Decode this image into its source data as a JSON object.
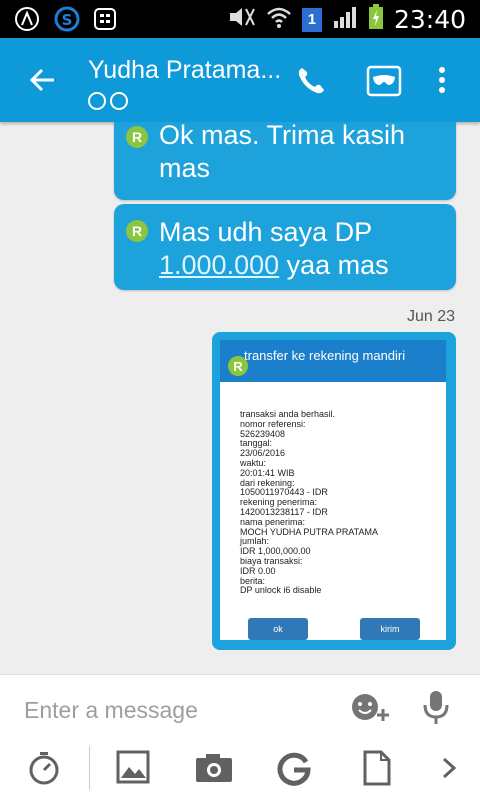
{
  "status_bar": {
    "time": "23:40",
    "sim_slot": "1",
    "icons": [
      "android-icon",
      "s-icon",
      "bbm-icon",
      "mute-icon",
      "wifi-icon",
      "signal-icon",
      "battery-charging-icon"
    ]
  },
  "app_bar": {
    "contact_name": "Yudha Pratama...",
    "back_icon": "back-arrow-icon",
    "call_icon": "phone-icon",
    "mask_icon": "mask-icon",
    "more_icon": "more-vert-icon"
  },
  "messages": [
    {
      "badge": "R",
      "text": "Ok mas. Trima kasih mas"
    },
    {
      "badge": "R",
      "text_before": "Mas udh saya DP ",
      "link": "1.000.000",
      "text_after": " yaa mas"
    }
  ],
  "date_label": "Jun 23",
  "image_message": {
    "badge": "R",
    "header": "transfer ke rekening mandiri",
    "lines": [
      "transaksi anda berhasil.",
      "nomor referensi:",
      "526239408",
      "tanggal:",
      "23/06/2016",
      "waktu:",
      "20:01:41 WIB",
      "dari rekening:",
      "1050011970443 - IDR",
      "rekening penerima:",
      "1420013238117 - IDR",
      "nama penerima:",
      "MOCH YUDHA PUTRA PRATAMA",
      "jumlah:",
      "IDR 1,000,000.00",
      "biaya transaksi:",
      "IDR 0.00",
      "berita:",
      "DP unlock i6 disable"
    ],
    "button_ok": "ok",
    "button_kirim": "kirim"
  },
  "input": {
    "placeholder": "Enter a message",
    "emoji_icon": "emoji-add-icon",
    "mic_icon": "microphone-icon"
  },
  "toolbar": {
    "icons": [
      "timer-icon",
      "image-icon",
      "camera-icon",
      "g-icon",
      "document-icon",
      "chevron-right-icon"
    ]
  },
  "colors": {
    "app_bar": "#0e9ad8",
    "bubble": "#1ea2dc",
    "badge": "#8cc63f"
  }
}
